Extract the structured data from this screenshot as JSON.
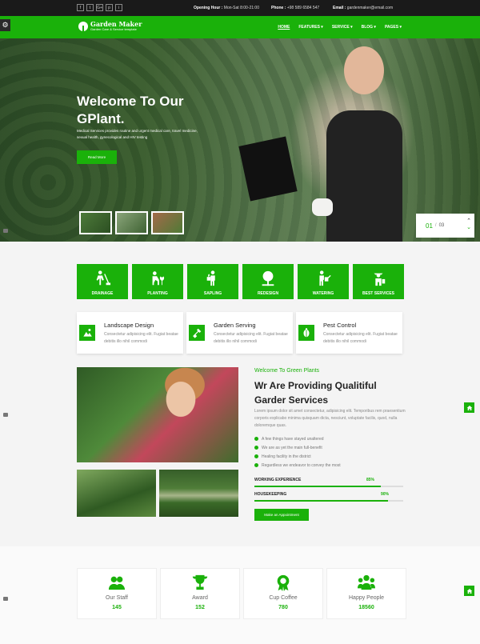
{
  "topbar": {
    "social": [
      "f",
      "t",
      "G+",
      "p",
      "i"
    ],
    "hours_label": "Opening Hour :",
    "hours_value": "Mon-Sat 8:00-21:00",
    "phone_label": "Phone :",
    "phone_value": "+98 589 6584 547",
    "email_label": "Email :",
    "email_value": "gardenmaker@email.com"
  },
  "header": {
    "logo_name": "Garden Maker",
    "logo_tagline": "Garden Care & Service template",
    "nav": [
      "HOME",
      "FEATURES",
      "SERVICE",
      "BLOG",
      "PAGES"
    ]
  },
  "hero": {
    "title_line1": "Welcome To Our",
    "title_line2": "GPlant.",
    "text": "Medical Services provides routine and urgent medical care, travel medicine, sexual health, gynecological and HIV testing",
    "button": "Read More",
    "current_slide": "01",
    "total_slides": "03"
  },
  "services": [
    {
      "label": "DRAINAGE",
      "icon": "person-digging-icon"
    },
    {
      "label": "PLANTING",
      "icon": "person-planting-icon"
    },
    {
      "label": "SAPLING",
      "icon": "person-sapling-icon"
    },
    {
      "label": "REDESIGN",
      "icon": "tree-icon"
    },
    {
      "label": "WATERING",
      "icon": "watering-can-icon"
    },
    {
      "label": "BEST SERVICES",
      "icon": "gardener-icon"
    }
  ],
  "features": [
    {
      "title": "Landscape Design",
      "desc": "Consectetur adipisicing elit. Fugiat beatae debitis illo nihil commodi",
      "icon": "landscape-icon"
    },
    {
      "title": "Garden Serving",
      "desc": "Consectetur adipisicing elit. Fugiat beatae debitis illo nihil commodi",
      "icon": "garden-tools-icon"
    },
    {
      "title": "Pest Control",
      "desc": "Consectetur adipisicing elit. Fugiat beatae debitis illo nihil commodi",
      "icon": "bug-icon"
    }
  ],
  "about": {
    "subtitle": "Welcome To Green Plants",
    "title": "Wr Are Providing Qualitiful Garder Services",
    "desc": "Lorem ipsum dolor sit amet consectetur, adipisicing elit. Temporibus rem praesentium corporis explicabo minima quisquam dicta, nesciunt, voluptate facilis, quod, nulla doloremque quas.",
    "checks": [
      "A few things have stayed unaltered",
      "We are as yet the main full-benefit",
      "Healing facility in the district",
      "Regardless we endeavor to convey the most"
    ],
    "skills": [
      {
        "name": "WORKING EXPERIENCE",
        "percent": "85%",
        "value": 85
      },
      {
        "name": "HOUSEKEEPING",
        "percent": "90%",
        "value": 90
      }
    ],
    "button": "Make an Appointment"
  },
  "stats": [
    {
      "label": "Our Staff",
      "value": "145",
      "icon": "staff-icon"
    },
    {
      "label": "Award",
      "value": "152",
      "icon": "trophy-icon"
    },
    {
      "label": "Cup Coffee",
      "value": "780",
      "icon": "badge-icon"
    },
    {
      "label": "Happy People",
      "value": "18560",
      "icon": "people-icon"
    }
  ],
  "colors": {
    "accent": "#1ab10a",
    "topbar": "#1a1a1a"
  }
}
